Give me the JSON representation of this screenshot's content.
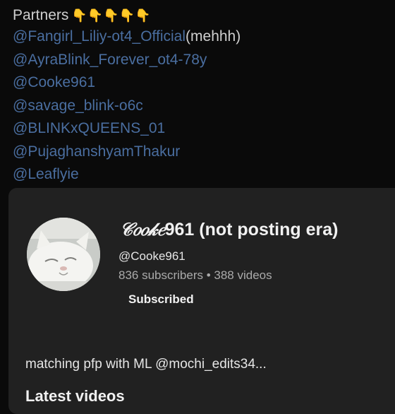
{
  "about": {
    "partners_label": "Partners",
    "partners_emoji": "👇👇👇👇👇",
    "partners": [
      {
        "handle": "@Fangirl_Liliy-ot4_Official",
        "note": "(mehhh)"
      },
      {
        "handle": "@AyraBlink_Forever_ot4-78y",
        "note": ""
      },
      {
        "handle": "@Cooke961",
        "note": ""
      },
      {
        "handle": "@savage_blink-o6c",
        "note": ""
      },
      {
        "handle": "@BLINKxQUEENS_01",
        "note": ""
      },
      {
        "handle": "@PujaghanshyamThakur",
        "note": ""
      },
      {
        "handle": "@Leaflyie",
        "note": ""
      }
    ]
  },
  "card": {
    "name_script": "𝒞𝑜𝑜𝓀𝑒",
    "name_rest": "961 (not posting era)",
    "handle": "@Cooke961",
    "stats": "836 subscribers • 388 videos",
    "subscribe_state": "Subscribed",
    "description": "matching pfp with ML @mochi_edits34...",
    "latest_label": "Latest videos"
  }
}
